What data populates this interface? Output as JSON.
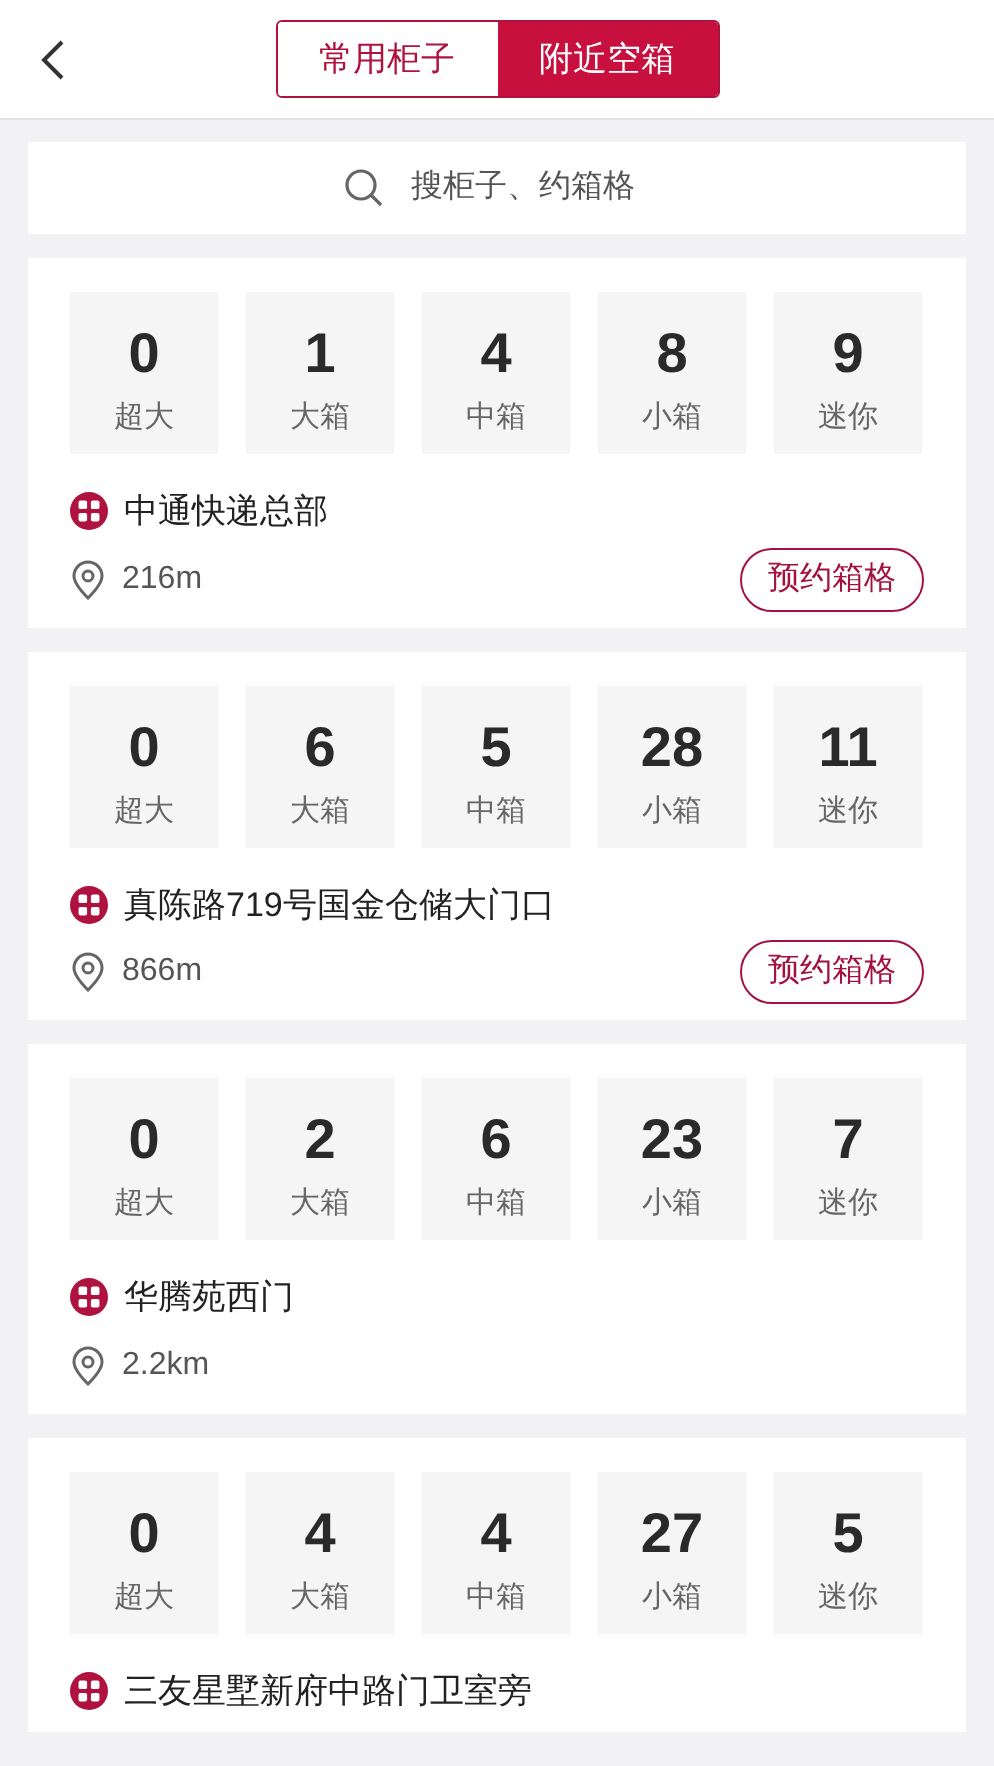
{
  "tabs": [
    {
      "label": "常用柜子",
      "selected": false
    },
    {
      "label": "附近空箱",
      "selected": true
    }
  ],
  "search": {
    "placeholder": "搜柜子、约箱格"
  },
  "lockers": [
    {
      "counts": [
        {
          "value": "0",
          "size": "超大"
        },
        {
          "value": "1",
          "size": "大箱"
        },
        {
          "value": "4",
          "size": "中箱"
        },
        {
          "value": "8",
          "size": "小箱"
        },
        {
          "value": "9",
          "size": "迷你"
        }
      ],
      "name": "中通快递总部",
      "distance": "216m",
      "button": "预约箱格"
    },
    {
      "counts": [
        {
          "value": "0",
          "size": "超大"
        },
        {
          "value": "6",
          "size": "大箱"
        },
        {
          "value": "5",
          "size": "中箱"
        },
        {
          "value": "28",
          "size": "小箱"
        },
        {
          "value": "11",
          "size": "迷你"
        }
      ],
      "name": "真陈路719号国金仓储大门口",
      "distance": "866m",
      "button": "预约箱格"
    },
    {
      "counts": [
        {
          "value": "0",
          "size": "超大"
        },
        {
          "value": "2",
          "size": "大箱"
        },
        {
          "value": "6",
          "size": "中箱"
        },
        {
          "value": "23",
          "size": "小箱"
        },
        {
          "value": "7",
          "size": "迷你"
        }
      ],
      "name": "华腾苑西门",
      "distance": "2.2km"
    },
    {
      "counts": [
        {
          "value": "0",
          "size": "超大"
        },
        {
          "value": "4",
          "size": "大箱"
        },
        {
          "value": "4",
          "size": "中箱"
        },
        {
          "value": "27",
          "size": "小箱"
        },
        {
          "value": "5",
          "size": "迷你"
        }
      ],
      "name": "三友星墅新府中路门卫室旁"
    }
  ]
}
